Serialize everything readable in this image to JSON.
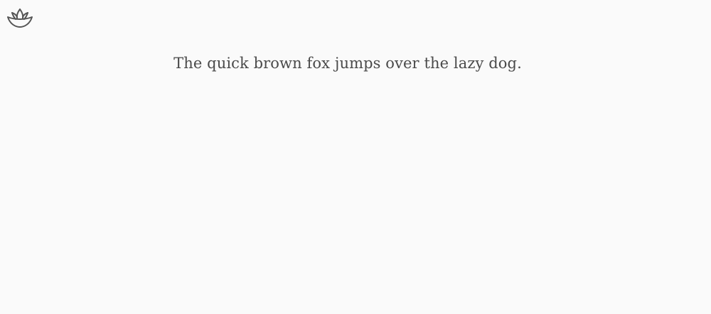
{
  "header": {
    "logo_icon": "lotus-icon"
  },
  "main": {
    "sample_text": "The quick brown fox jumps over the lazy dog."
  },
  "colors": {
    "background": "#fafafa",
    "text": "#4a4a4a",
    "icon_stroke": "#555555"
  }
}
